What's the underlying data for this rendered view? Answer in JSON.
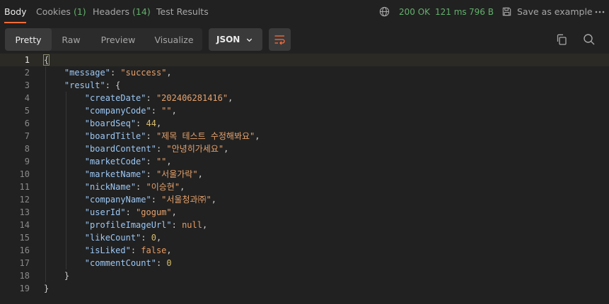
{
  "tabs": [
    {
      "label": "Body",
      "count": "",
      "active": true
    },
    {
      "label": "Cookies",
      "count": "(1)",
      "active": false
    },
    {
      "label": "Headers",
      "count": "(14)",
      "active": false
    },
    {
      "label": "Test Results",
      "count": "",
      "active": false
    }
  ],
  "status": {
    "code": "200 OK",
    "time": "121 ms",
    "size": "796 B"
  },
  "save_example_label": "Save as example",
  "view_modes": [
    "Pretty",
    "Raw",
    "Preview",
    "Visualize"
  ],
  "active_view_mode": "Pretty",
  "language": "JSON",
  "icons": {
    "globe": "globe-icon",
    "save": "save-icon",
    "more": "more-icon",
    "chevron": "chevron-down-icon",
    "wrap": "wrap-lines-icon",
    "copy": "copy-icon",
    "search": "search-icon"
  },
  "colors": {
    "accent": "#ff6c37",
    "status_ok": "#62b16b",
    "json_key": "#9cc8f5",
    "json_string": "#e6a26c",
    "json_number": "#d7bd6a"
  },
  "code": {
    "current_line": 1,
    "lines": [
      {
        "no": "1",
        "indent": "",
        "tokens": [
          {
            "t": "p",
            "v": "{"
          }
        ]
      },
      {
        "no": "2",
        "indent": "    ",
        "tokens": [
          {
            "t": "k",
            "v": "\"message\""
          },
          {
            "t": "p",
            "v": ": "
          },
          {
            "t": "s",
            "v": "\"success\""
          },
          {
            "t": "p",
            "v": ","
          }
        ]
      },
      {
        "no": "3",
        "indent": "    ",
        "tokens": [
          {
            "t": "k",
            "v": "\"result\""
          },
          {
            "t": "p",
            "v": ": {"
          }
        ]
      },
      {
        "no": "4",
        "indent": "        ",
        "tokens": [
          {
            "t": "k",
            "v": "\"createDate\""
          },
          {
            "t": "p",
            "v": ": "
          },
          {
            "t": "s",
            "v": "\"202406281416\""
          },
          {
            "t": "p",
            "v": ","
          }
        ]
      },
      {
        "no": "5",
        "indent": "        ",
        "tokens": [
          {
            "t": "k",
            "v": "\"companyCode\""
          },
          {
            "t": "p",
            "v": ": "
          },
          {
            "t": "s",
            "v": "\"\""
          },
          {
            "t": "p",
            "v": ","
          }
        ]
      },
      {
        "no": "6",
        "indent": "        ",
        "tokens": [
          {
            "t": "k",
            "v": "\"boardSeq\""
          },
          {
            "t": "p",
            "v": ": "
          },
          {
            "t": "n",
            "v": "44"
          },
          {
            "t": "p",
            "v": ","
          }
        ]
      },
      {
        "no": "7",
        "indent": "        ",
        "tokens": [
          {
            "t": "k",
            "v": "\"boardTitle\""
          },
          {
            "t": "p",
            "v": ": "
          },
          {
            "t": "s",
            "v": "\"제목 테스트 수정해봐요\""
          },
          {
            "t": "p",
            "v": ","
          }
        ]
      },
      {
        "no": "8",
        "indent": "        ",
        "tokens": [
          {
            "t": "k",
            "v": "\"boardContent\""
          },
          {
            "t": "p",
            "v": ": "
          },
          {
            "t": "s",
            "v": "\"안녕히가세요\""
          },
          {
            "t": "p",
            "v": ","
          }
        ]
      },
      {
        "no": "9",
        "indent": "        ",
        "tokens": [
          {
            "t": "k",
            "v": "\"marketCode\""
          },
          {
            "t": "p",
            "v": ": "
          },
          {
            "t": "s",
            "v": "\"\""
          },
          {
            "t": "p",
            "v": ","
          }
        ]
      },
      {
        "no": "10",
        "indent": "        ",
        "tokens": [
          {
            "t": "k",
            "v": "\"marketName\""
          },
          {
            "t": "p",
            "v": ": "
          },
          {
            "t": "s",
            "v": "\"서울가락\""
          },
          {
            "t": "p",
            "v": ","
          }
        ]
      },
      {
        "no": "11",
        "indent": "        ",
        "tokens": [
          {
            "t": "k",
            "v": "\"nickName\""
          },
          {
            "t": "p",
            "v": ": "
          },
          {
            "t": "s",
            "v": "\"이승현\""
          },
          {
            "t": "p",
            "v": ","
          }
        ]
      },
      {
        "no": "12",
        "indent": "        ",
        "tokens": [
          {
            "t": "k",
            "v": "\"companyName\""
          },
          {
            "t": "p",
            "v": ": "
          },
          {
            "t": "s",
            "v": "\"서울청과㈜\""
          },
          {
            "t": "p",
            "v": ","
          }
        ]
      },
      {
        "no": "13",
        "indent": "        ",
        "tokens": [
          {
            "t": "k",
            "v": "\"userId\""
          },
          {
            "t": "p",
            "v": ": "
          },
          {
            "t": "s",
            "v": "\"gogum\""
          },
          {
            "t": "p",
            "v": ","
          }
        ]
      },
      {
        "no": "14",
        "indent": "        ",
        "tokens": [
          {
            "t": "k",
            "v": "\"profileImageUrl\""
          },
          {
            "t": "p",
            "v": ": "
          },
          {
            "t": "kw",
            "v": "null"
          },
          {
            "t": "p",
            "v": ","
          }
        ]
      },
      {
        "no": "15",
        "indent": "        ",
        "tokens": [
          {
            "t": "k",
            "v": "\"likeCount\""
          },
          {
            "t": "p",
            "v": ": "
          },
          {
            "t": "n",
            "v": "0"
          },
          {
            "t": "p",
            "v": ","
          }
        ]
      },
      {
        "no": "16",
        "indent": "        ",
        "tokens": [
          {
            "t": "k",
            "v": "\"isLiked\""
          },
          {
            "t": "p",
            "v": ": "
          },
          {
            "t": "kw",
            "v": "false"
          },
          {
            "t": "p",
            "v": ","
          }
        ]
      },
      {
        "no": "17",
        "indent": "        ",
        "tokens": [
          {
            "t": "k",
            "v": "\"commentCount\""
          },
          {
            "t": "p",
            "v": ": "
          },
          {
            "t": "n",
            "v": "0"
          }
        ]
      },
      {
        "no": "18",
        "indent": "    ",
        "tokens": [
          {
            "t": "p",
            "v": "}"
          }
        ]
      },
      {
        "no": "19",
        "indent": "",
        "tokens": [
          {
            "t": "p",
            "v": "}"
          }
        ]
      }
    ]
  }
}
